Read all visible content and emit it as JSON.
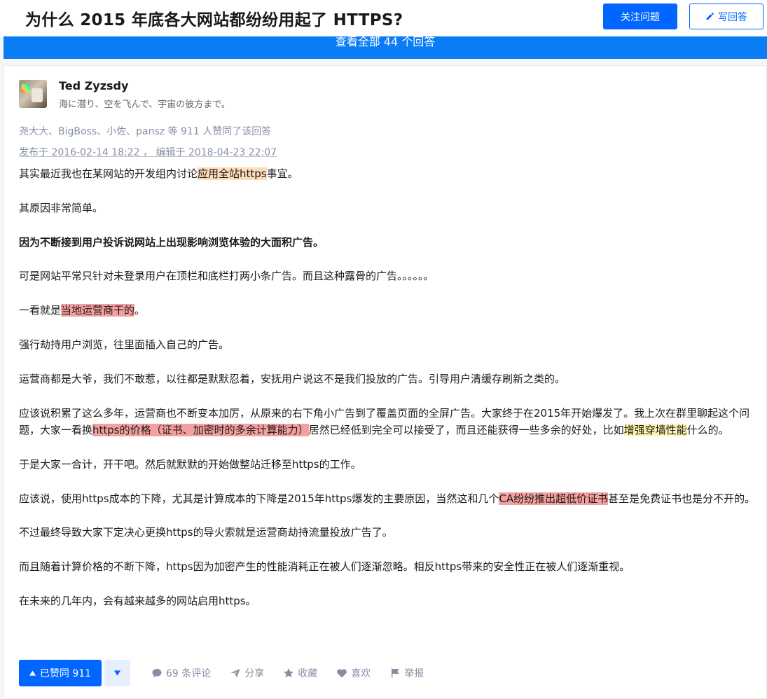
{
  "header": {
    "question_title": "为什么 2015 年底各大网站都纷纷用起了 HTTPS?",
    "follow_label": "关注问题",
    "write_label": "写回答"
  },
  "view_all_label": "查看全部 44 个回答",
  "answer": {
    "author_name": "Ted Zyzsdy",
    "author_bio": "海に潜り、空を飞んで、宇宙の彼方まで。",
    "vote_info": "尧大大、BigBoss、小佐、pansz 等 911 人赞同了该回答",
    "meta_time": "发布于 2016-02-14 18:22 ， 编辑于 2018-04-23 22:07",
    "paragraphs": {
      "p1": {
        "a": "其实最近我也在某网站的开发组内讨论",
        "hl": "应用全站https",
        "b": "事宜。"
      },
      "p2": "其原因非常简单。",
      "p3": "因为不断接到用户投诉说网站上出现影响浏览体验的大面积广告。",
      "p4": "可是网站平常只针对未登录用户在顶栏和底栏打两小条广告。而且这种露骨的广告。。。。。。",
      "p5": {
        "a": "一看就是",
        "hl": "当地运营商干的",
        "b": "。"
      },
      "p6": "强行劫持用户浏览，往里面插入自己的广告。",
      "p7": "运营商都是大爷，我们不敢惹，以往都是默默忍着，安抚用户说这不是我们投放的广告。引导用户清缓存刷新之类的。",
      "p8": {
        "a": "应该说积累了这么多年，运营商也不断变本加厉，从原来的右下角小广告到了覆盖页面的全屏广告。大家终于在2015年开始爆发了。我上次在群里聊起这个问题，大家一看换",
        "hl1": "https的价格（证书、加密时的多余计算能力）",
        "b": "居然已经低到完全可以接受了，而且还能获得一些多余的好处，比如",
        "hl2": "增强穿墙性能",
        "c": "什么的。"
      },
      "p9": "于是大家一合计，开干吧。然后就默默的开始做整站迁移至https的工作。",
      "p10": {
        "a": "应该说，使用https成本的下降，尤其是计算成本的下降是2015年https爆发的主要原因，当然这和几个",
        "hl": "CA纷纷推出超低价证书",
        "b": "甚至是免费证书也是分不开的。"
      },
      "p11": "不过最终导致大家下定决心更换https的导火索就是运营商劫持流量投放广告了。",
      "p12": "而且随着计算价格的不断下降，https因为加密产生的性能消耗正在被人们逐渐忽略。相反https带来的安全性正在被人们逐渐重视。",
      "p13": "在未来的几年内，会有越来越多的网站启用https。"
    }
  },
  "actions": {
    "upvote_label": "已赞同 911",
    "comments_label": "69 条评论",
    "share_label": "分享",
    "collect_label": "收藏",
    "like_label": "喜欢",
    "report_label": "举报"
  },
  "colors": {
    "brand_blue": "#0066ff",
    "view_all_blue": "#0a7cf6",
    "highlight_orange": "#ffdcb8",
    "highlight_red": "#f5a0a0",
    "highlight_yellow": "#fff5b3",
    "meta_gray": "#8590a6"
  },
  "icons": [
    "pencil-icon",
    "upvote-triangle-icon",
    "downvote-triangle-icon",
    "comment-icon",
    "share-icon",
    "star-icon",
    "heart-icon",
    "flag-icon"
  ]
}
